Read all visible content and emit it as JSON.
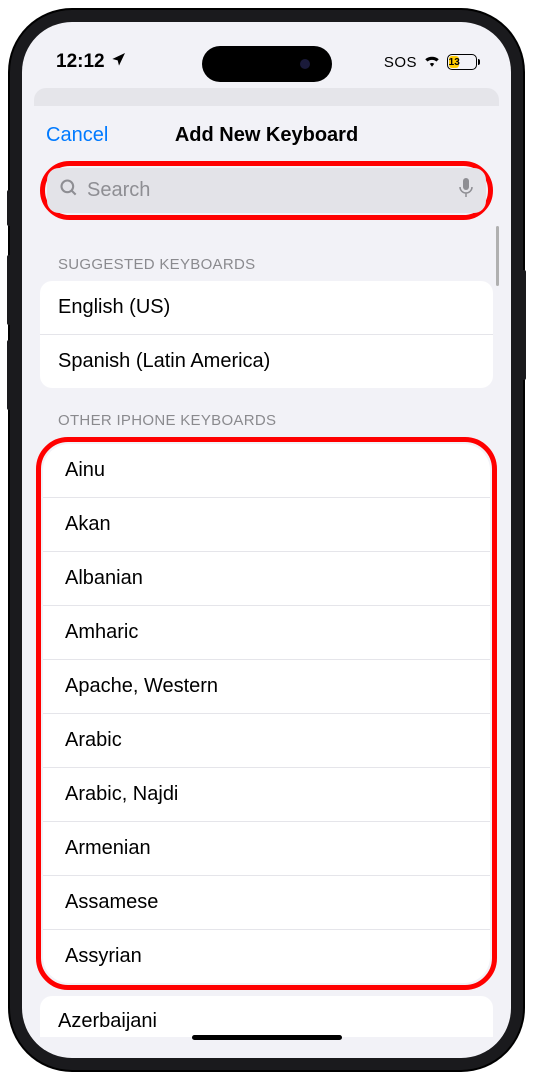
{
  "status": {
    "time": "12:12",
    "sos": "SOS",
    "battery_percent": "13",
    "battery_width": "13%"
  },
  "nav": {
    "cancel": "Cancel",
    "title": "Add New Keyboard"
  },
  "search": {
    "placeholder": "Search"
  },
  "sections": {
    "suggested_header": "SUGGESTED KEYBOARDS",
    "other_header": "OTHER IPHONE KEYBOARDS"
  },
  "suggested": [
    "English (US)",
    "Spanish (Latin America)"
  ],
  "other": [
    "Ainu",
    "Akan",
    "Albanian",
    "Amharic",
    "Apache, Western",
    "Arabic",
    "Arabic, Najdi",
    "Armenian",
    "Assamese",
    "Assyrian"
  ],
  "overflow_item": "Azerbaijani"
}
